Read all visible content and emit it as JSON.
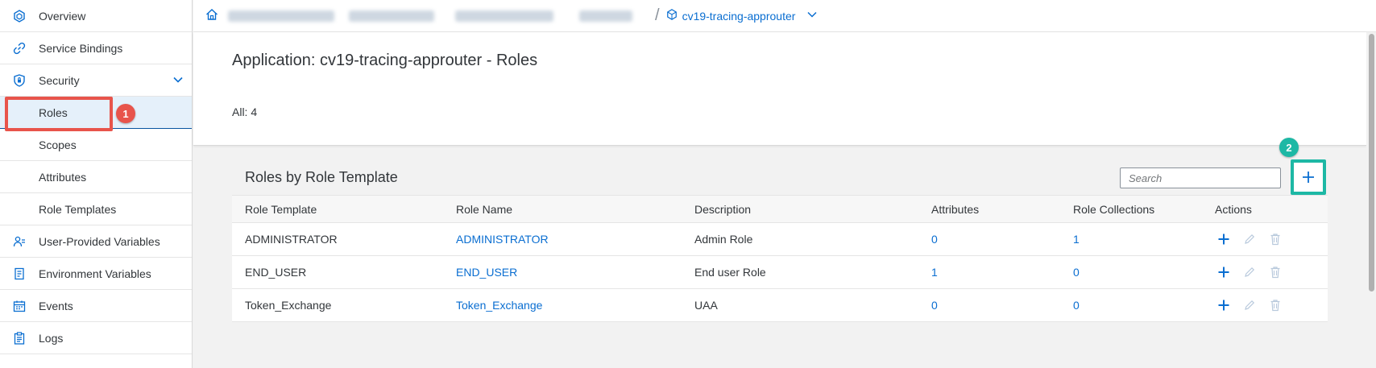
{
  "sidebar": {
    "items": [
      {
        "label": "Overview",
        "icon": "overview-icon"
      },
      {
        "label": "Service Bindings",
        "icon": "link-icon"
      },
      {
        "label": "Security",
        "icon": "shield-icon"
      },
      {
        "label": "Roles"
      },
      {
        "label": "Scopes"
      },
      {
        "label": "Attributes"
      },
      {
        "label": "Role Templates"
      },
      {
        "label": "User-Provided Variables",
        "icon": "user-variables-icon"
      },
      {
        "label": "Environment Variables",
        "icon": "document-icon"
      },
      {
        "label": "Events",
        "icon": "calendar-icon"
      },
      {
        "label": "Logs",
        "icon": "clipboard-icon"
      }
    ],
    "selected": "Roles"
  },
  "annotations": {
    "step1": "1",
    "step2": "2"
  },
  "breadcrumb": {
    "current": "cv19-tracing-approuter"
  },
  "header": {
    "title": "Application: cv19-tracing-approuter - Roles",
    "count": "All: 4"
  },
  "panel": {
    "title": "Roles by Role Template",
    "search_placeholder": "Search",
    "columns": [
      "Role Template",
      "Role Name",
      "Description",
      "Attributes",
      "Role Collections",
      "Actions"
    ],
    "rows": [
      {
        "template": "ADMINISTRATOR",
        "name": "ADMINISTRATOR",
        "description": "Admin Role",
        "attributes": "0",
        "collections": "1"
      },
      {
        "template": "END_USER",
        "name": "END_USER",
        "description": "End user Role",
        "attributes": "1",
        "collections": "0"
      },
      {
        "template": "Token_Exchange",
        "name": "Token_Exchange",
        "description": "UAA",
        "attributes": "0",
        "collections": "0"
      }
    ]
  },
  "colors": {
    "accent": "#0a6ed1",
    "annotation_red": "#e8544b",
    "annotation_green": "#1db8a5"
  }
}
